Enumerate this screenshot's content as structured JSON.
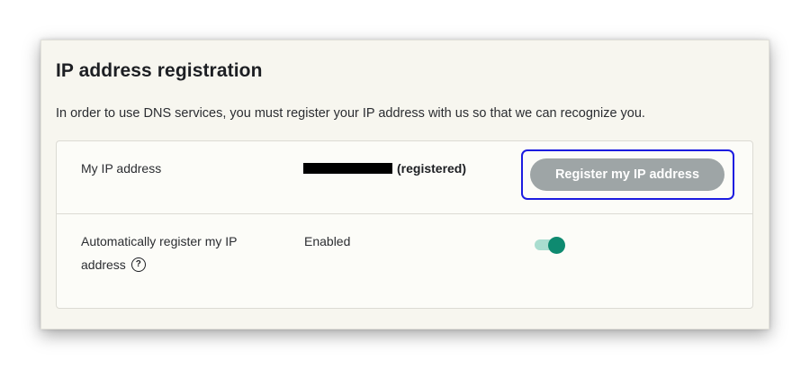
{
  "section": {
    "title": "IP address registration",
    "description": "In order to use DNS services, you must register your IP address with us so that we can recognize you."
  },
  "ip_row": {
    "label": "My IP address",
    "status": "(registered)",
    "button_label": "Register my IP address"
  },
  "auto_row": {
    "label": "Automatically register my IP address",
    "help_icon_glyph": "?",
    "value": "Enabled",
    "toggle_on": true
  },
  "colors": {
    "panel_background": "#f7f6ef",
    "button_disabled": "#9ea5a6",
    "highlight_border": "#1c1ce0",
    "toggle_knob": "#0e8a70",
    "toggle_track": "#a9ddcf"
  },
  "icons": {
    "help": "question-circle-icon"
  }
}
